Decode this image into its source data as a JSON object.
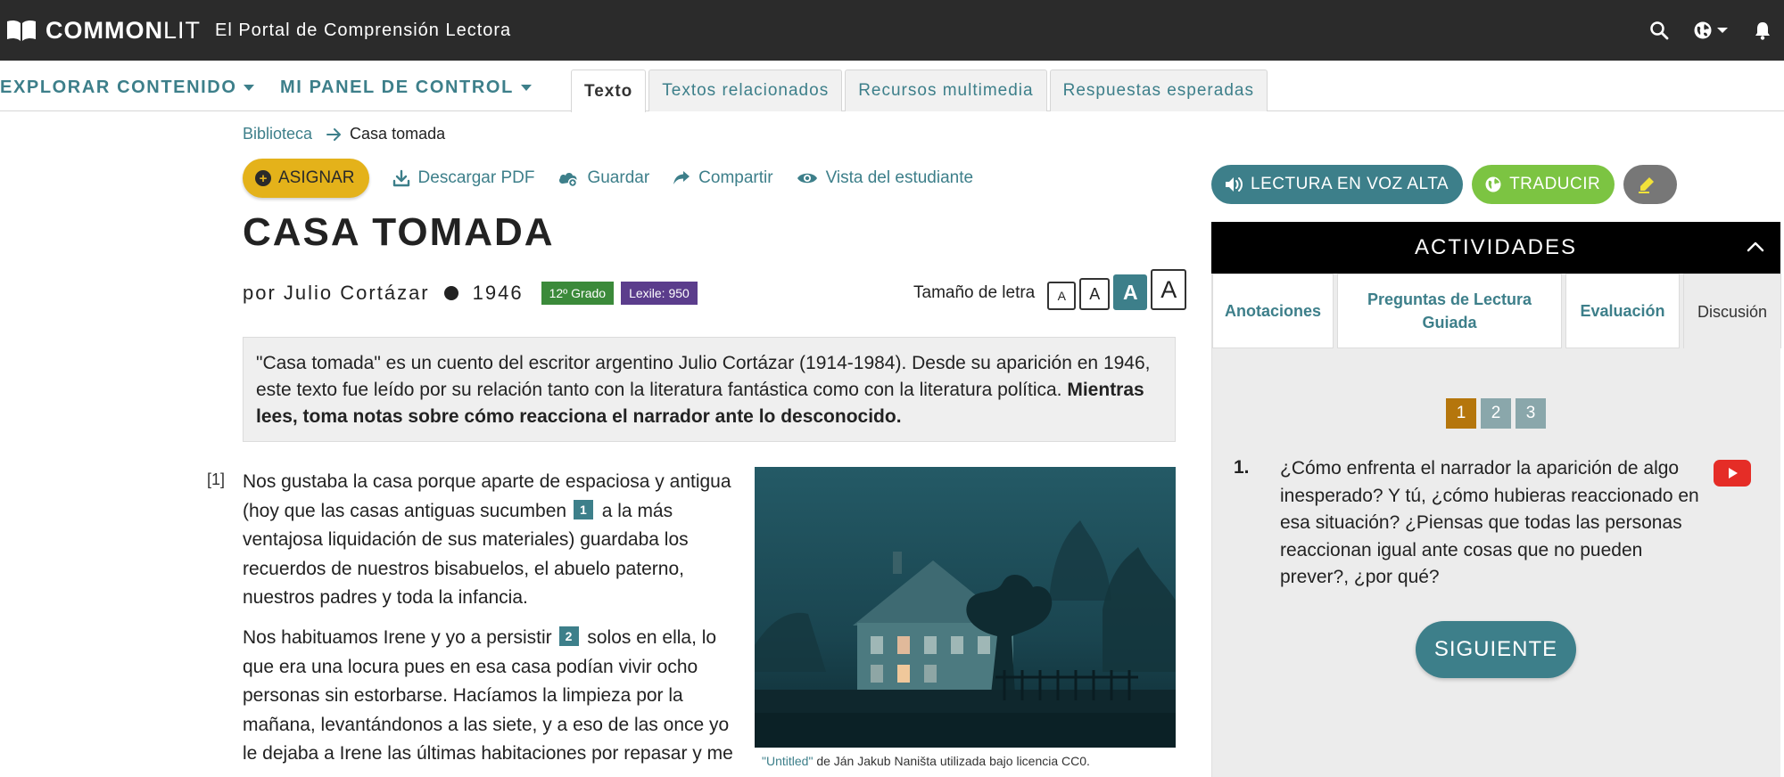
{
  "header": {
    "brand_bold": "COMMON",
    "brand_light": "LIT",
    "subtitle": "El Portal de Comprensión Lectora"
  },
  "nav": {
    "explore": "EXPLORAR CONTENIDO",
    "dashboard": "MI PANEL DE CONTROL",
    "tabs": [
      {
        "label": "Texto",
        "active": true
      },
      {
        "label": "Textos relacionados",
        "active": false
      },
      {
        "label": "Recursos multimedia",
        "active": false
      },
      {
        "label": "Respuestas esperadas",
        "active": false
      }
    ]
  },
  "breadcrumb": {
    "library": "Biblioteca",
    "current": "Casa tomada"
  },
  "actions": {
    "assign": "ASIGNAR",
    "download": "Descargar PDF",
    "save": "Guardar",
    "share": "Compartir",
    "student_view": "Vista del estudiante"
  },
  "text": {
    "title": "CASA TOMADA",
    "author": "por Julio Cortázar",
    "year": "1946",
    "grade": "12º Grado",
    "lexile": "Lexile: 950",
    "font_size_label": "Tamaño de letra",
    "font_size_glyph": "A",
    "font_size_selected": 3
  },
  "intro": {
    "plain": "\"Casa tomada\" es un cuento del escritor argentino Julio Cortázar (1914-1984). Desde su aparición en 1946, este texto fue leído por su relación tanto con la literatura fantástica como con la literatura política.",
    "bold": "Mientras lees, toma notas sobre cómo reacciona el narrador ante lo desconocido."
  },
  "body": {
    "para_number": "[1]",
    "p1_a": "Nos gustaba la casa porque aparte de espaciosa y antigua (hoy que las casas antiguas sucumben",
    "fn1": "1",
    "p1_b": "a la más ventajosa liquidación de sus materiales) guardaba los recuerdos de nuestros bisabuelos, el abuelo paterno, nuestros padres y toda la infancia.",
    "p2_a": "Nos habituamos Irene y yo a persistir",
    "fn2": "2",
    "p2_b": "solos en ella, lo que era una locura pues en esa casa podían vivir ocho personas sin estorbarse. Hacíamos la limpieza por la mañana, levantándonos a las siete, y a eso de las once yo le dejaba a Irene las últimas habitaciones por repasar y me"
  },
  "image": {
    "caption_link": "\"Untitled\"",
    "caption_rest": "de Ján Jakub Naništa utilizada bajo licencia CC0."
  },
  "right": {
    "read_aloud": "LECTURA EN VOZ ALTA",
    "translate": "TRADUCIR",
    "activities": "ACTIVIDADES",
    "tabs": [
      {
        "label": "Anotaciones",
        "active": false
      },
      {
        "label": "Preguntas de Lectura Guiada",
        "active": false
      },
      {
        "label": "Evaluación",
        "active": false
      },
      {
        "label": "Discusión",
        "active": true
      }
    ],
    "pages": [
      "1",
      "2",
      "3"
    ],
    "active_page": "1",
    "question_number": "1.",
    "question": "¿Cómo enfrenta el narrador la aparición de algo inesperado? Y tú, ¿cómo hubieras reaccionado en esa situación? ¿Piensas que todas las personas reaccionan igual ante cosas que no pueden prever?, ¿por qué?",
    "next": "SIGUIENTE"
  },
  "colors": {
    "teal": "#3d7f8a",
    "assign_yellow": "#e4b21a",
    "translate_green": "#7cc442",
    "grade_green": "#3b8a3a",
    "lexile_purple": "#5b3d8c",
    "page_active": "#b5760c",
    "topbar": "#2b2b2b"
  }
}
